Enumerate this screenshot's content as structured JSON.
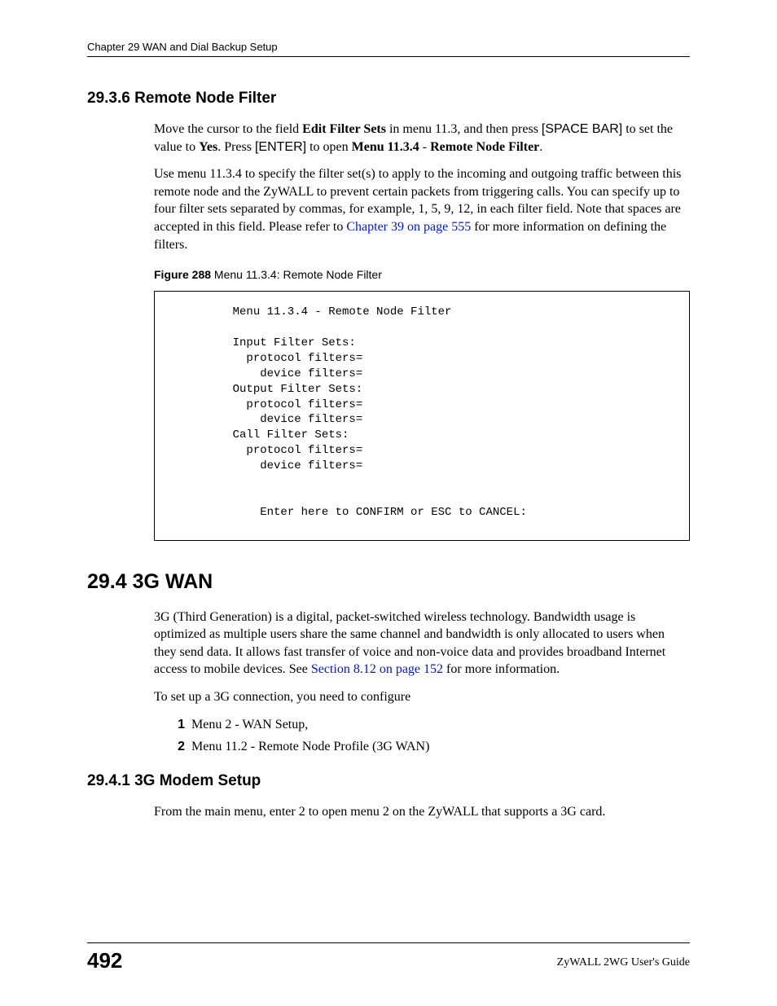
{
  "header": {
    "chapter_line": "Chapter 29 WAN and Dial Backup Setup"
  },
  "section_2936": {
    "heading": "29.3.6  Remote Node Filter",
    "p1_a": "Move the cursor to the field ",
    "p1_b": "Edit Filter Sets",
    "p1_c": " in menu 11.3, and then press ",
    "p1_d": "[SPACE BAR]",
    "p1_e": " to set the value to ",
    "p1_f": "Yes",
    "p1_g": ". Press ",
    "p1_h": "[ENTER]",
    "p1_i": " to open ",
    "p1_j": "Menu 11.3.4",
    "p1_k": " - ",
    "p1_l": "Remote Node Filter",
    "p1_m": ".",
    "p2_a": "Use menu 11.3.4 to specify the filter set(s) to apply to the incoming and outgoing traffic between this remote node and the ZyWALL to prevent certain packets from triggering calls. You can specify up to four filter sets separated by commas, for example, 1, 5, 9, 12, in each filter field. Note that spaces are accepted in this field. Please refer to ",
    "p2_link": "Chapter 39 on page 555",
    "p2_b": " for more information on defining the filters."
  },
  "figure288": {
    "label": "Figure 288",
    "caption": "   Menu 11.3.4: Remote Node Filter",
    "code": "         Menu 11.3.4 - Remote Node Filter\n\n         Input Filter Sets:\n           protocol filters=\n             device filters=\n         Output Filter Sets:\n           protocol filters=\n             device filters=\n         Call Filter Sets:\n           protocol filters=\n             device filters=\n\n\n             Enter here to CONFIRM or ESC to CANCEL:"
  },
  "section_294": {
    "heading": "29.4  3G WAN",
    "p1_a": "3G (Third Generation) is a digital, packet-switched wireless technology. Bandwidth usage is optimized as multiple users share the same channel and bandwidth is only allocated to users when they send data. It allows fast transfer of voice and non-voice data and provides broadband Internet access to mobile devices. See ",
    "p1_link": "Section 8.12 on page 152",
    "p1_b": " for more information.",
    "p2": "To set up a 3G connection, you need to configure",
    "list": {
      "item1": "Menu 2 - WAN Setup,",
      "item2": "Menu 11.2 - Remote Node Profile (3G WAN)"
    }
  },
  "section_2941": {
    "heading": "29.4.1  3G Modem Setup",
    "p1": "From the main menu, enter 2 to open menu 2 on the ZyWALL that supports a 3G card."
  },
  "footer": {
    "page_number": "492",
    "guide": "ZyWALL 2WG User's Guide"
  }
}
